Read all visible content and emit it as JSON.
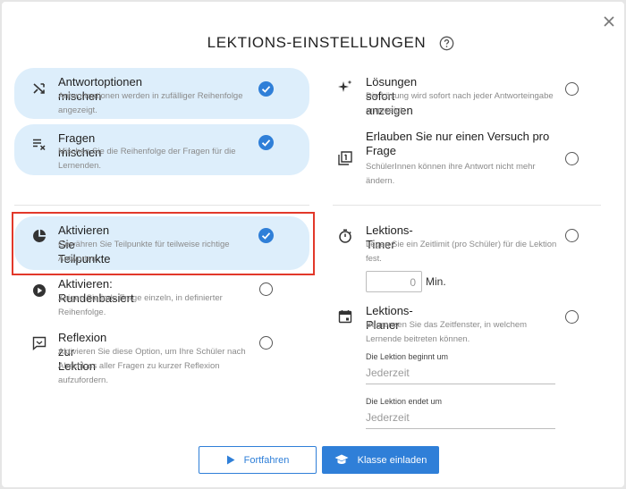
{
  "modal": {
    "title": "LEKTIONS-EINSTELLUNGEN",
    "help_icon": "help-circle-icon",
    "close_icon": "close-icon"
  },
  "left_options": [
    {
      "title": "Antwortoptionen mischen",
      "desc": "Antwortoptionen werden in zufälliger Reihenfolge angezeigt.",
      "icon": "shuffle-icon",
      "selected": true
    },
    {
      "title": "Fragen mischen",
      "desc": "Mischen Sie die Reihenfolge der Fragen für die Lernenden.",
      "icon": "shuffle-list-icon",
      "selected": true
    },
    {
      "title": "Aktivieren Sie Teilpunkte",
      "desc": "Gewähren Sie Teilpunkte für teilweise richtige Antworten.",
      "icon": "pie-chart-icon",
      "selected": true
    },
    {
      "title": "Aktivieren: Rundenbasiert",
      "desc": "Zeigen Sie jede Frage einzeln, in definierter Reihenfolge.",
      "icon": "play-circle-icon",
      "selected": false
    },
    {
      "title": "Reflexion zur Lektion",
      "desc": "Aktivieren Sie diese Option, um Ihre Schüler nach Abschluss aller Fragen zu kurzer Reflexion aufzufordern.",
      "icon": "feedback-icon",
      "selected": false
    }
  ],
  "right_options": [
    {
      "title": "Lösungen sofort anzeigen",
      "desc": "Die Lösung wird sofort nach jeder Antworteingabe angezeigt.",
      "icon": "sparkle-icon",
      "selected": false
    },
    {
      "title": "Erlauben Sie nur einen Versuch pro Frage",
      "desc": "SchülerInnen können ihre Antwort nicht mehr ändern.",
      "icon": "filter-one-icon",
      "selected": false
    },
    {
      "title": "Lektions-Timer",
      "desc": "Legen Sie ein Zeitlimit (pro Schüler) für die Lektion fest.",
      "icon": "timer-icon",
      "selected": false
    },
    {
      "title": "Lektions-Planer",
      "desc": "Begrenzen Sie das Zeitfenster, in welchem Lernende beitreten können.",
      "icon": "calendar-icon",
      "selected": false
    }
  ],
  "timer": {
    "value": "0",
    "unit": "Min."
  },
  "planner": {
    "start_label": "Die Lektion beginnt um",
    "start_value": "Jederzeit",
    "end_label": "Die Lektion endet um",
    "end_value": "Jederzeit"
  },
  "buttons": {
    "continue_label": "Fortfahren",
    "invite_label": "Klasse einladen"
  },
  "colors": {
    "accent": "#2f7fd8",
    "selected_bg": "#ddeefb",
    "highlight": "#e2382a"
  }
}
